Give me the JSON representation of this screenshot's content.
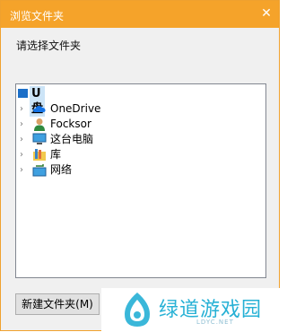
{
  "window": {
    "title": "浏览文件夹",
    "close_glyph": "✕",
    "accent": "#f5a32a"
  },
  "dialog": {
    "prompt": "请选择文件夹",
    "new_folder_label": "新建文件夹(M)"
  },
  "tree": {
    "root": {
      "label": "U盘",
      "icon": "usb-drive-icon",
      "selected": true
    },
    "items": [
      {
        "label": "OneDrive",
        "icon": "onedrive-cloud-icon",
        "chevron": "›"
      },
      {
        "label": "Focksor",
        "icon": "user-icon",
        "chevron": "›"
      },
      {
        "label": "这台电脑",
        "icon": "computer-icon",
        "chevron": "›"
      },
      {
        "label": "库",
        "icon": "library-icon",
        "chevron": "›"
      },
      {
        "label": "网络",
        "icon": "network-icon",
        "chevron": "›"
      }
    ]
  },
  "watermark": {
    "text": "绿道游戏园",
    "subtext": "LDYC.NET"
  }
}
